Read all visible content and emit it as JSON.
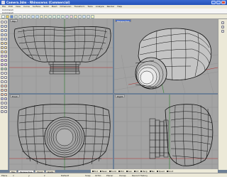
{
  "window": {
    "title": "Camera.3dm - Rhinoceros (Commercial)"
  },
  "menu": [
    "File",
    "Edit",
    "View",
    "Curve",
    "Surface",
    "Solid",
    "Mesh",
    "Dimension",
    "Transform",
    "Tools",
    "Analyze",
    "Render",
    "Help"
  ],
  "command": {
    "lines": [
      "Command:",
      "Command:"
    ]
  },
  "viewports": {
    "top": {
      "label": "Top"
    },
    "perspective": {
      "label": "Perspective"
    },
    "front": {
      "label": "Front"
    },
    "right": {
      "label": "Right"
    }
  },
  "tabs": [
    "Top",
    "Perspective",
    "Front",
    "Right"
  ],
  "osnap": [
    "End",
    "Near",
    "Point",
    "Mid",
    "Cen",
    "Int",
    "Perp",
    "Tan",
    "Quad",
    "Knot"
  ],
  "status": {
    "plane": "Plane",
    "x": "x",
    "y": "y",
    "z": "z",
    "layer": "Default",
    "snap": "Snap",
    "ortho": "Ortho",
    "planar": "Planar",
    "osnap": "Osnap",
    "record": "Record History"
  },
  "colors": {
    "viewport_bg": "#a3a3a3",
    "wire": "#101010",
    "grid": "#8e8e8e",
    "axis_red": "#b03030",
    "axis_green": "#308030",
    "title_blue": "#2452b8"
  }
}
